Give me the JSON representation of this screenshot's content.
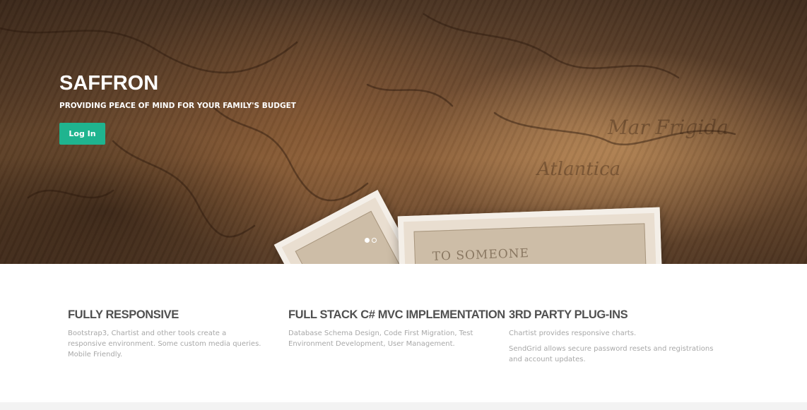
{
  "hero": {
    "title": "SAFFRON",
    "subtitle": "PROVIDING PEACE OF MIND FOR YOUR FAMILY'S BUDGET",
    "login_label": "Log In",
    "card_text": "TO SOMEONE",
    "slides": {
      "count": 2,
      "active": 1
    }
  },
  "features": [
    {
      "title": "FULLY RESPONSIVE",
      "paragraphs": [
        "Bootstrap3, Chartist and other tools create a responsive environment. Some custom media queries. Mobile Friendly."
      ]
    },
    {
      "title": "FULL STACK C# MVC IMPLEMENTATION",
      "paragraphs": [
        "Database Schema Design, Code First Migration, Test Environment Development, User Management."
      ]
    },
    {
      "title": "3RD PARTY PLUG-INS",
      "paragraphs": [
        "Chartist provides responsive charts.",
        "SendGrid allows secure password resets and registrations and account updates."
      ]
    }
  ],
  "colors": {
    "accent": "#1fb48f",
    "heading": "#505050",
    "body_text": "#a8a8a8"
  }
}
